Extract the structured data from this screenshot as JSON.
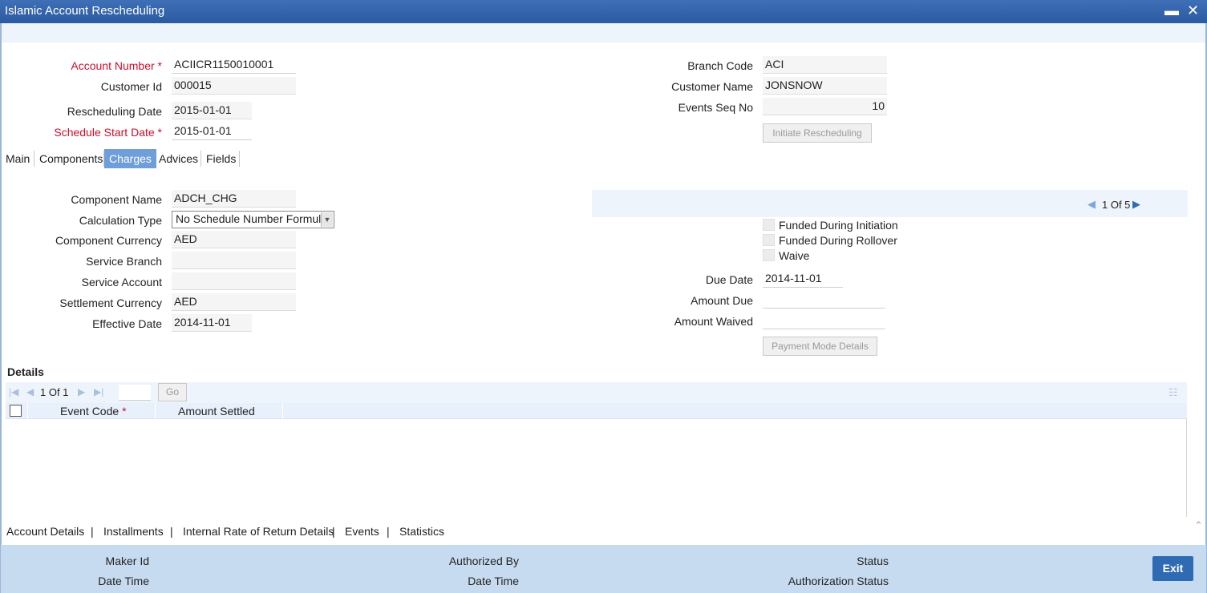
{
  "window": {
    "title": "Islamic Account Rescheduling",
    "minimize_glyph": "▬",
    "close_glyph": "✕"
  },
  "header": {
    "account_number": {
      "label": "Account Number",
      "value": "ACIICR1150010001"
    },
    "customer_id": {
      "label": "Customer Id",
      "value": "000015"
    },
    "rescheduling_date": {
      "label": "Rescheduling Date",
      "value": "2015-01-01"
    },
    "schedule_start_date": {
      "label": "Schedule Start Date",
      "value": "2015-01-01"
    },
    "branch_code": {
      "label": "Branch Code",
      "value": "ACI"
    },
    "customer_name": {
      "label": "Customer Name",
      "value": "JONSNOW"
    },
    "events_seq_no": {
      "label": "Events Seq No",
      "value": "10"
    },
    "initiate_button": "Initiate Rescheduling",
    "required_mark": "*"
  },
  "tabs": [
    {
      "label": "Main"
    },
    {
      "label": "Components"
    },
    {
      "label": "Charges",
      "active": true
    },
    {
      "label": "Advices"
    },
    {
      "label": "Fields"
    }
  ],
  "charges": {
    "component_name": {
      "label": "Component Name",
      "value": "ADCH_CHG"
    },
    "calculation_type": {
      "label": "Calculation Type",
      "value": "No Schedule Number Formula"
    },
    "component_currency": {
      "label": "Component Currency",
      "value": "AED"
    },
    "service_branch": {
      "label": "Service Branch",
      "value": ""
    },
    "service_account": {
      "label": "Service Account",
      "value": ""
    },
    "settlement_currency": {
      "label": "Settlement Currency",
      "value": "AED"
    },
    "effective_date": {
      "label": "Effective Date",
      "value": "2014-11-01"
    },
    "pager": "1 Of 5",
    "funded_during_initiation": "Funded During Initiation",
    "funded_during_rollover": "Funded During Rollover",
    "waive": "Waive",
    "due_date": {
      "label": "Due Date",
      "value": "2014-11-01"
    },
    "amount_due": {
      "label": "Amount Due",
      "value": ""
    },
    "amount_waived": {
      "label": "Amount Waived",
      "value": ""
    },
    "payment_mode_button": "Payment Mode Details"
  },
  "details": {
    "title": "Details",
    "pager": "1 Of 1",
    "go_button": "Go",
    "columns": [
      {
        "label": "Event Code",
        "required": "*"
      },
      {
        "label": "Amount Settled"
      }
    ],
    "rows": []
  },
  "bottom_links": [
    "Account Details",
    "Installments",
    "Internal Rate of Return Details",
    "Events",
    "Statistics"
  ],
  "link_separator": "|",
  "audit": {
    "maker_id": "Maker Id",
    "maker_date_time": "Date Time",
    "authorized_by": "Authorized By",
    "auth_date_time": "Date Time",
    "status": "Status",
    "authorization_status": "Authorization Status",
    "exit_button": "Exit"
  },
  "colors": {
    "accent": "#2f6bb3",
    "required": "#c8102e",
    "active_tab": "#6f9ed8",
    "audit_bg": "#c7dbf0"
  }
}
